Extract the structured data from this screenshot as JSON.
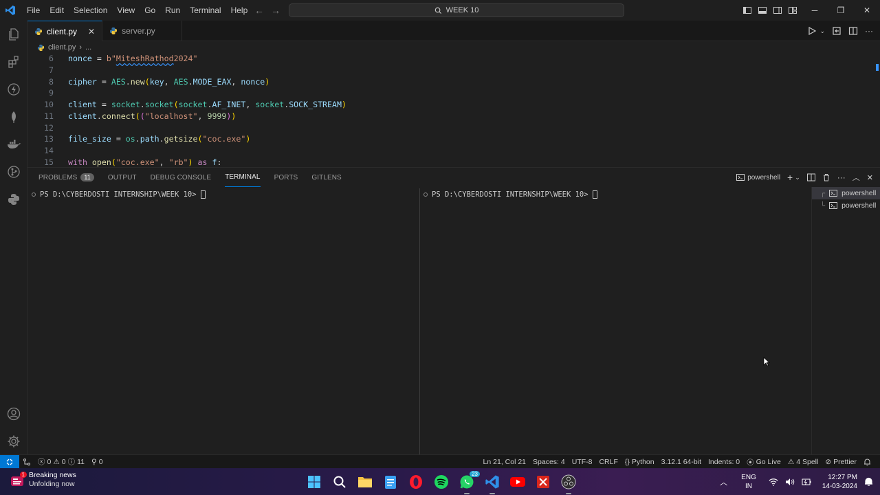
{
  "titlebar": {
    "menu": [
      "File",
      "Edit",
      "Selection",
      "View",
      "Go",
      "Run",
      "Terminal",
      "Help"
    ],
    "search_text": "WEEK 10"
  },
  "activity_bar": [
    "explorer-icon",
    "extensions-icon",
    "lightning-icon",
    "mongodb-leaf-icon",
    "docker-icon",
    "gitlens-icon",
    "python-icon",
    "account-icon",
    "settings-gear-icon"
  ],
  "tabs": [
    {
      "label": "client.py",
      "active": true
    },
    {
      "label": "server.py",
      "active": false
    }
  ],
  "breadcrumb": {
    "file": "client.py",
    "rest": "..."
  },
  "code": {
    "line_numbers": [
      "6",
      "7",
      "8",
      "9",
      "10",
      "11",
      "12",
      "13",
      "14",
      "15"
    ],
    "lines": [
      "nonce = b\"MiteshRathod2024\"",
      "",
      "cipher = AES.new(key, AES.MODE_EAX, nonce)",
      "",
      "client = socket.socket(socket.AF_INET, socket.SOCK_STREAM)",
      "client.connect((\"localhost\", 9999))",
      "",
      "file_size = os.path.getsize(\"coc.exe\")",
      "",
      "with open(\"coc.exe\", \"rb\") as f:"
    ]
  },
  "panel": {
    "tabs": [
      {
        "label": "PROBLEMS",
        "badge": "11"
      },
      {
        "label": "OUTPUT"
      },
      {
        "label": "DEBUG CONSOLE"
      },
      {
        "label": "TERMINAL",
        "active": true
      },
      {
        "label": "PORTS"
      },
      {
        "label": "GITLENS"
      }
    ],
    "terminal_profile": "powershell",
    "terminals": [
      {
        "prompt": "PS D:\\CYBERDOSTI INTERNSHIP\\WEEK 10>"
      },
      {
        "prompt": "PS D:\\CYBERDOSTI INTERNSHIP\\WEEK 10>"
      }
    ],
    "terminal_list": [
      "powershell",
      "powershell"
    ]
  },
  "statusbar": {
    "errors": "0",
    "warnings": "0",
    "infos": "11",
    "ports": "0",
    "position": "Ln 21, Col 21",
    "spaces": "Spaces: 4",
    "encoding": "UTF-8",
    "eol": "CRLF",
    "language": "Python",
    "interpreter": "3.12.1 64-bit",
    "indents": "Indents: 0",
    "golive": "Go Live",
    "spell": "4 Spell",
    "prettier": "Prettier"
  },
  "taskbar": {
    "news_title": "Breaking news",
    "news_sub": "Unfolding now",
    "news_badge": "1",
    "whatsapp_badge": "23",
    "lang_top": "ENG",
    "lang_bottom": "IN",
    "time": "12:27 PM",
    "date": "14-03-2024"
  },
  "colors": {
    "accent": "#0078d4",
    "background": "#1f1f1f",
    "statusbar": "#181818"
  }
}
